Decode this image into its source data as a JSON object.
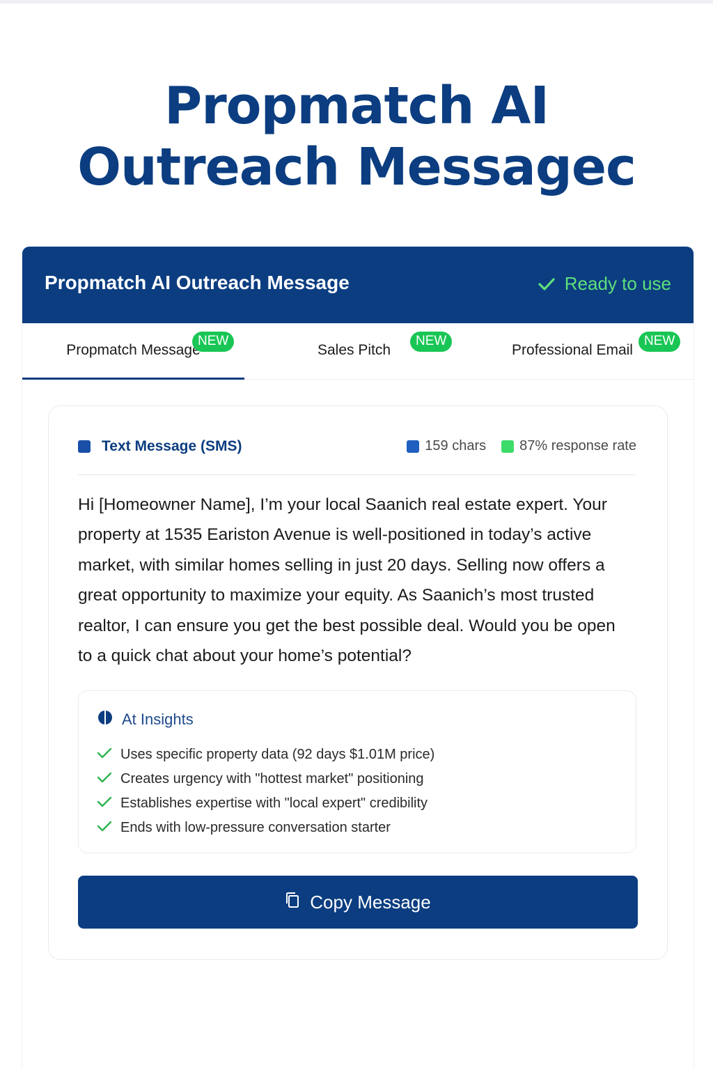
{
  "page": {
    "title_line1": "Propmatch AI",
    "title_line2": "Outreach Messagec"
  },
  "header": {
    "title": "Propmatch AI Outreach Message",
    "status": "Ready to use",
    "status_icon": "check-icon"
  },
  "tabs": [
    {
      "label": "Propmatch Message",
      "badge": "NEW",
      "active": true
    },
    {
      "label": "Sales Pitch",
      "badge": "NEW",
      "active": false
    },
    {
      "label": "Professional Email",
      "badge": "NEW",
      "active": false
    }
  ],
  "message": {
    "type_label": "Text Message (SMS)",
    "chars": "159 chars",
    "response_rate": "87% response rate",
    "lines": [
      "Hi [Homeowner Name], I’m your local Saanich real estate expert. Your",
      "property at 1535 Eariston Avenue is well-positioned in today’s active",
      "market, with similar homes selling in just 20 days. Selling now offers a",
      "great opportunity to maximize your equity. As Saanich’s most trusted",
      "realtor, I can ensure you get the best possible deal. Would you be open",
      "to a quick chat about your home’s potential?"
    ]
  },
  "insights": {
    "title": "At Insights",
    "items": [
      "Uses specific property data (92 days  $1.01M price)",
      "Creates urgency with \"hottest market\" positioning",
      "Establishes expertise with \"local expert\" credibility",
      "Ends with low-pressure conversation starter"
    ]
  },
  "actions": {
    "copy_label": "Copy Message"
  },
  "colors": {
    "brand": "#0b3d80",
    "badge": "#19c655",
    "ready": "#5ee07b",
    "chars_dot": "#1f5fbf",
    "response_dot": "#3ddc6a"
  }
}
